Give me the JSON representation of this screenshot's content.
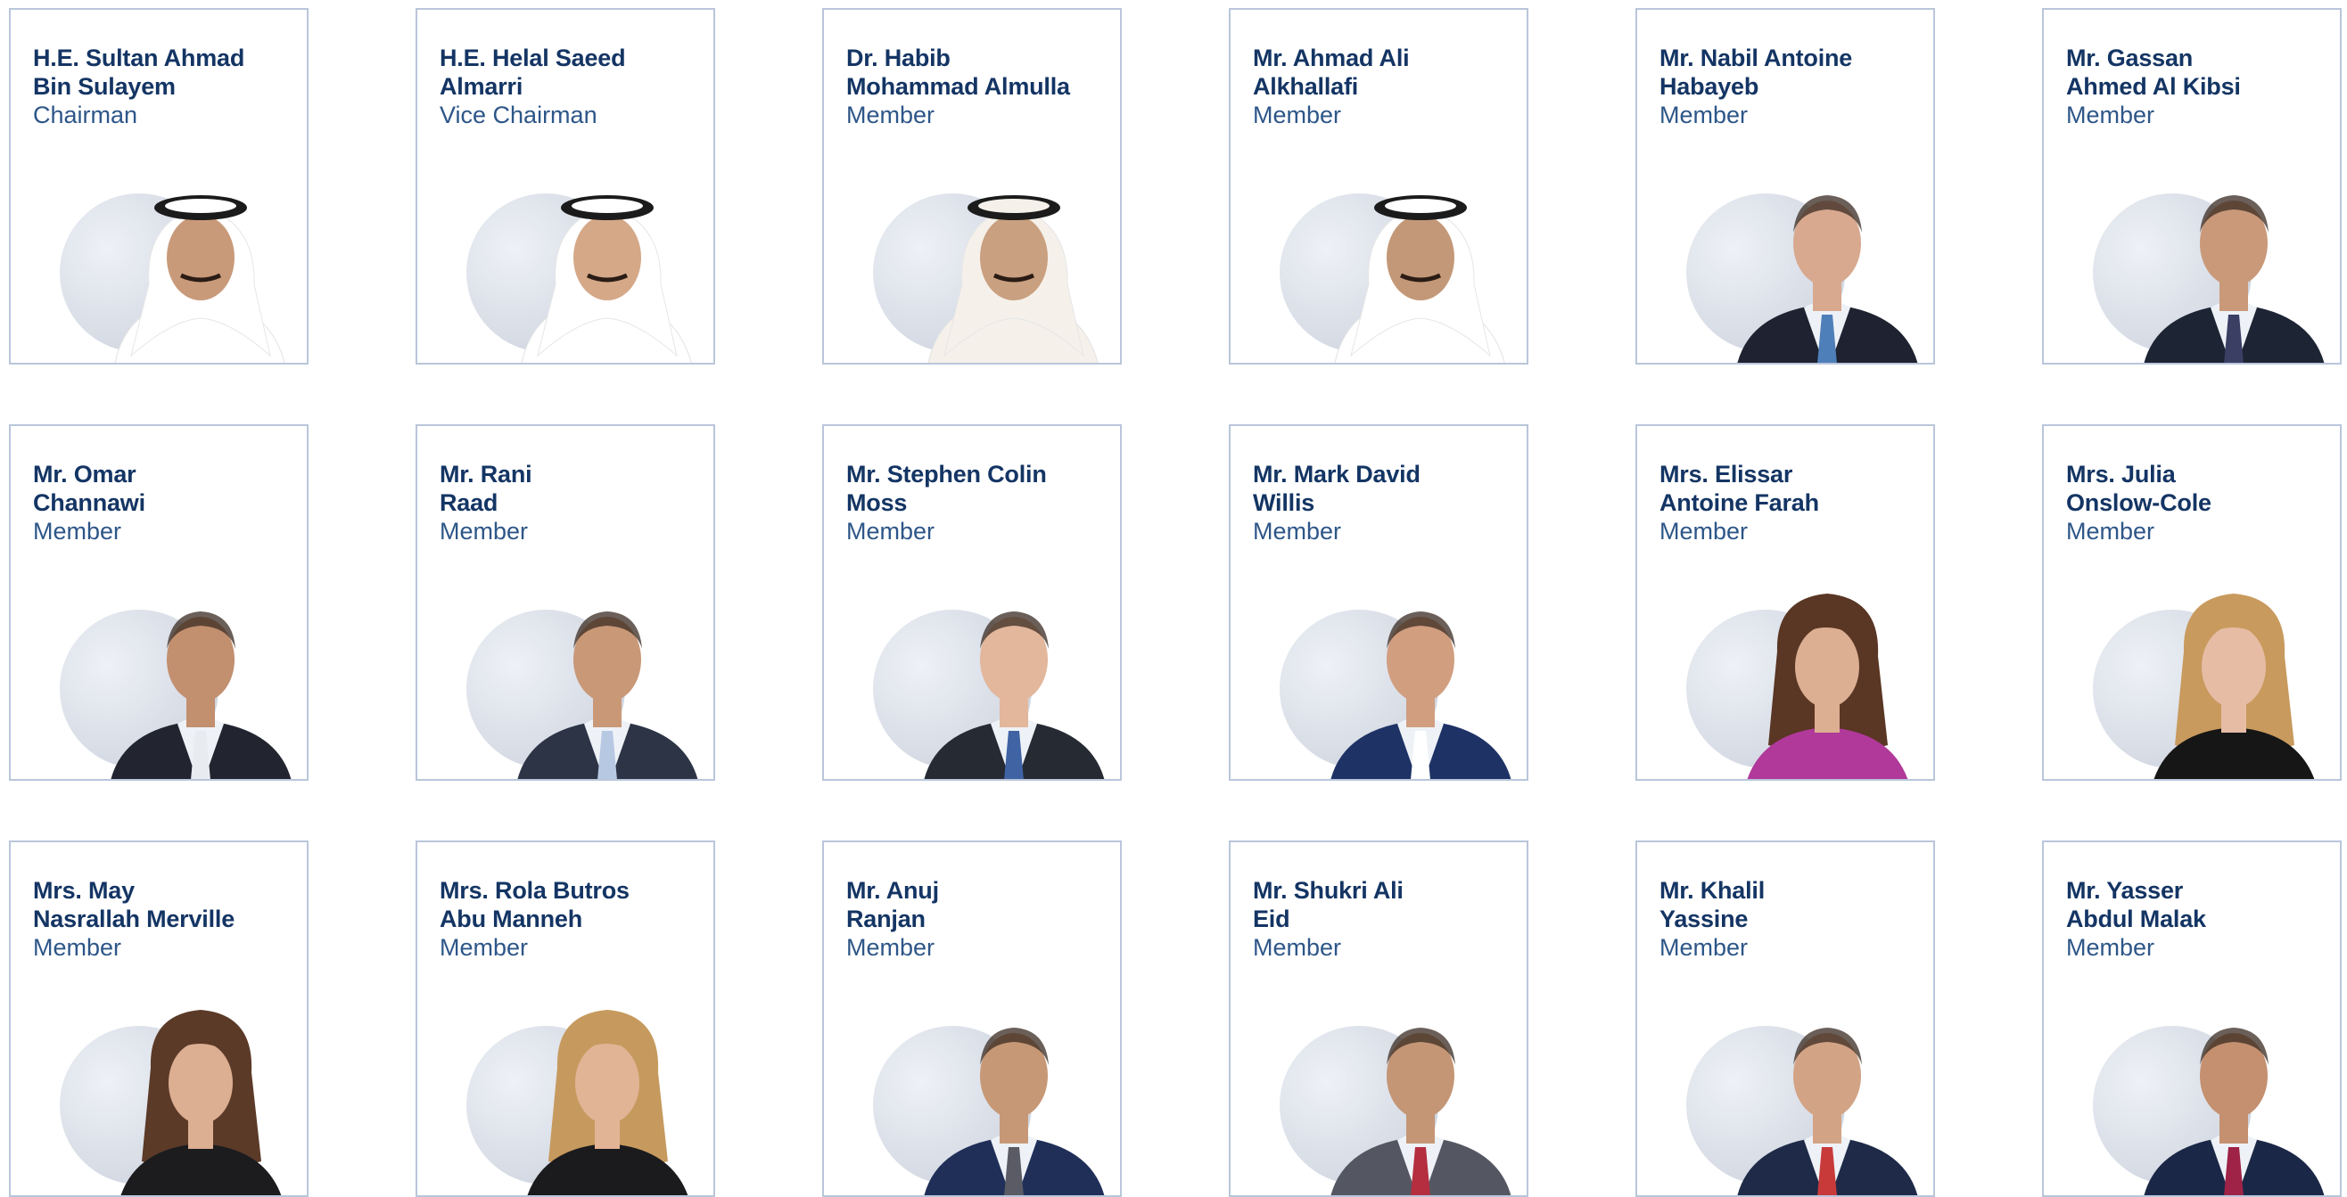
{
  "members": [
    {
      "name_line1": "H.E. Sultan Ahmad",
      "name_line2": "Bin Sulayem",
      "role": "Chairman",
      "attire": "traditional",
      "skin": "#c99a7a",
      "ghutra": "#ffffff"
    },
    {
      "name_line1": "H.E. Helal Saeed",
      "name_line2": "Almarri",
      "role": "Vice Chairman",
      "attire": "traditional",
      "skin": "#d5a888",
      "ghutra": "#ffffff"
    },
    {
      "name_line1": "Dr. Habib",
      "name_line2": "Mohammad Almulla",
      "role": "Member",
      "attire": "traditional",
      "skin": "#c9a080",
      "ghutra": "#f5f1ea"
    },
    {
      "name_line1": "Mr. Ahmad Ali",
      "name_line2": "Alkhallafi",
      "role": "Member",
      "attire": "traditional",
      "skin": "#c39878",
      "ghutra": "#ffffff"
    },
    {
      "name_line1": "Mr. Nabil Antoine",
      "name_line2": "Habayeb",
      "role": "Member",
      "attire": "suit",
      "skin": "#d8a98f",
      "suit": "#1f2230",
      "tie": "#4f7fb8"
    },
    {
      "name_line1": "Mr. Gassan",
      "name_line2": "Ahmed Al Kibsi",
      "role": "Member",
      "attire": "suit",
      "skin": "#c9997a",
      "suit": "#1d2433",
      "tie": "#3a3f63"
    },
    {
      "name_line1": "Mr. Omar",
      "name_line2": "Channawi",
      "role": "Member",
      "attire": "suit",
      "skin": "#c28f6f",
      "suit": "#222530",
      "tie": "#e8ecf0"
    },
    {
      "name_line1": "Mr. Rani",
      "name_line2": "Raad",
      "role": "Member",
      "attire": "suit",
      "skin": "#c99877",
      "suit": "#2c3446",
      "tie": "#b7c8e3"
    },
    {
      "name_line1": "Mr. Stephen Colin",
      "name_line2": "Moss",
      "role": "Member",
      "attire": "suit",
      "skin": "#e2b79c",
      "suit": "#262a33",
      "tie": "#3f63a3"
    },
    {
      "name_line1": "Mr. Mark David",
      "name_line2": "Willis",
      "role": "Member",
      "attire": "suit",
      "skin": "#d19e80",
      "suit": "#1e3266",
      "tie": "#ffffff"
    },
    {
      "name_line1": "Mrs. Elissar",
      "name_line2": "Antoine Farah",
      "role": "Member",
      "attire": "woman",
      "skin": "#dcae92",
      "hair": "#5a3624",
      "top": "#b0399a"
    },
    {
      "name_line1": "Mrs. Julia",
      "name_line2": "Onslow-Cole",
      "role": "Member",
      "attire": "woman",
      "skin": "#e6bca5",
      "hair": "#c89a5d",
      "top": "#161616"
    },
    {
      "name_line1": "Mrs. May",
      "name_line2": "Nasrallah Merville",
      "role": "Member",
      "attire": "woman",
      "skin": "#dcae92",
      "hair": "#5b3a28",
      "top": "#1c1c1f"
    },
    {
      "name_line1": "Mrs. Rola Butros",
      "name_line2": "Abu Manneh",
      "role": "Member",
      "attire": "woman",
      "skin": "#e2b496",
      "hair": "#c69a5e",
      "top": "#1b1b1e"
    },
    {
      "name_line1": "Mr. Anuj",
      "name_line2": "Ranjan",
      "role": "Member",
      "attire": "suit",
      "skin": "#c79876",
      "suit": "#1f2f58",
      "tie": "#5b5b66"
    },
    {
      "name_line1": "Mr. Shukri Ali",
      "name_line2": "Eid",
      "role": "Member",
      "attire": "suit",
      "skin": "#c49676",
      "suit": "#545762",
      "tie": "#b42e3f"
    },
    {
      "name_line1": "Mr. Khalil",
      "name_line2": "Yassine",
      "role": "Member",
      "attire": "suit",
      "skin": "#d3a385",
      "suit": "#1e2a48",
      "tie": "#c83a3a"
    },
    {
      "name_line1": "Mr. Yasser",
      "name_line2": "Abdul Malak",
      "role": "Member",
      "attire": "suit",
      "skin": "#c4906f",
      "suit": "#1b2746",
      "tie": "#9e2346"
    }
  ],
  "colors": {
    "border": "#b9c6db",
    "name": "#143564",
    "role": "#2d5688"
  }
}
